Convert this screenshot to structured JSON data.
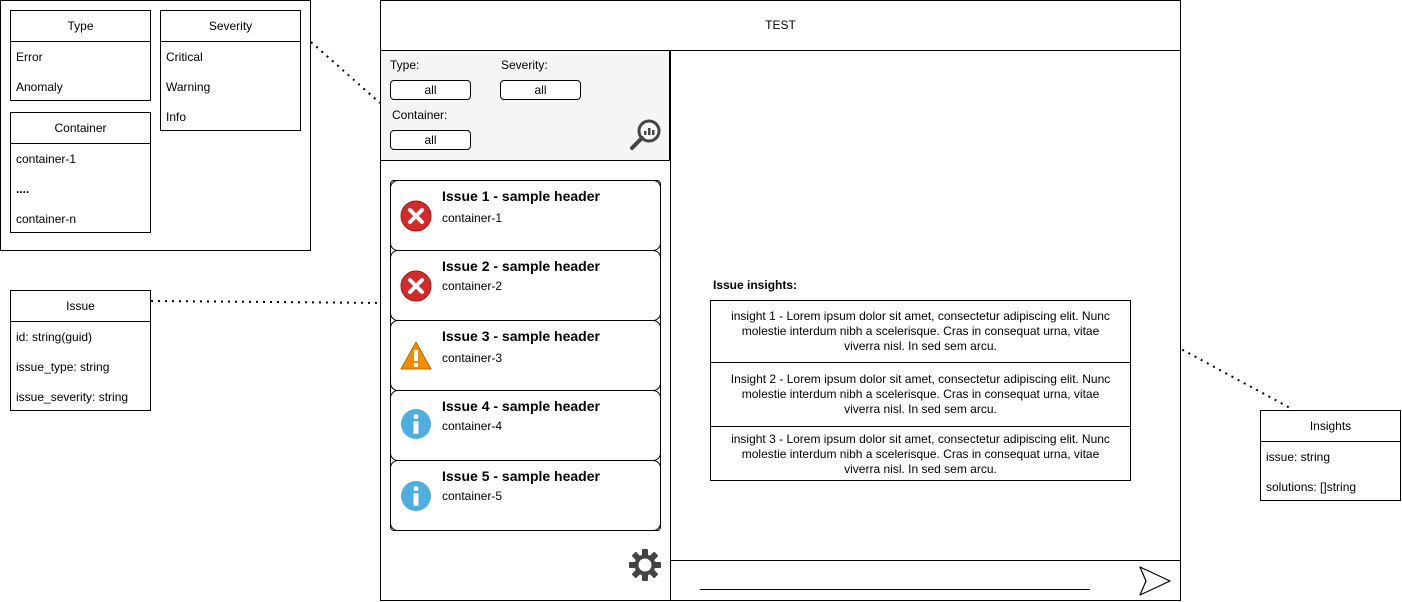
{
  "left_diagram": {
    "type_class": {
      "title": "Type",
      "items": [
        "Error",
        "Anomaly"
      ]
    },
    "severity_class": {
      "title": "Severity",
      "items": [
        "Critical",
        "Warning",
        "Info"
      ]
    },
    "container_class": {
      "title": "Container",
      "items": [
        "container-1",
        "....",
        "container-n"
      ]
    },
    "issue_class": {
      "title": "Issue",
      "items": [
        "id: string(guid)",
        "issue_type: string",
        "issue_severity: string"
      ]
    }
  },
  "insights_class": {
    "title": "Insights",
    "items": [
      "issue: string",
      "solutions: []string"
    ]
  },
  "app": {
    "title": "TEST",
    "filters": {
      "type_label": "Type:",
      "type_value": "all",
      "severity_label": "Severity:",
      "severity_value": "all",
      "container_label": "Container:",
      "container_value": "all"
    },
    "issues": [
      {
        "title": "Issue 1 - sample header",
        "container": "container-1",
        "icon": "error-icon"
      },
      {
        "title": "Issue 2 - sample header",
        "container": "container-2",
        "icon": "error-icon"
      },
      {
        "title": "Issue 3 - sample header",
        "container": "container-3",
        "icon": "warning-icon"
      },
      {
        "title": "Issue 4 - sample header",
        "container": "container-4",
        "icon": "info-icon"
      },
      {
        "title": "Issue 5 - sample header",
        "container": "container-5",
        "icon": "info-icon"
      }
    ],
    "insights_heading": "Issue insights:",
    "insights": [
      "insight 1 - Lorem ipsum dolor sit amet, consectetur adipiscing elit. Nunc molestie interdum nibh a scelerisque. Cras in consequat urna, vitae viverra nisl. In sed sem arcu.",
      "Insight 2 - Lorem ipsum dolor sit amet, consectetur adipiscing elit. Nunc molestie interdum nibh a scelerisque. Cras in consequat urna, vitae viverra nisl. In sed sem arcu.",
      "insight 3 - Lorem ipsum dolor sit amet, consectetur adipiscing elit. Nunc molestie interdum nibh a scelerisque. Cras in consequat urna, vitae viverra nisl. In sed sem arcu."
    ]
  },
  "colors": {
    "panel_gray": "#f5f5f5",
    "error_red": "#d42a2a",
    "warning_orange": "#f08c00",
    "info_blue": "#4eaee0"
  }
}
